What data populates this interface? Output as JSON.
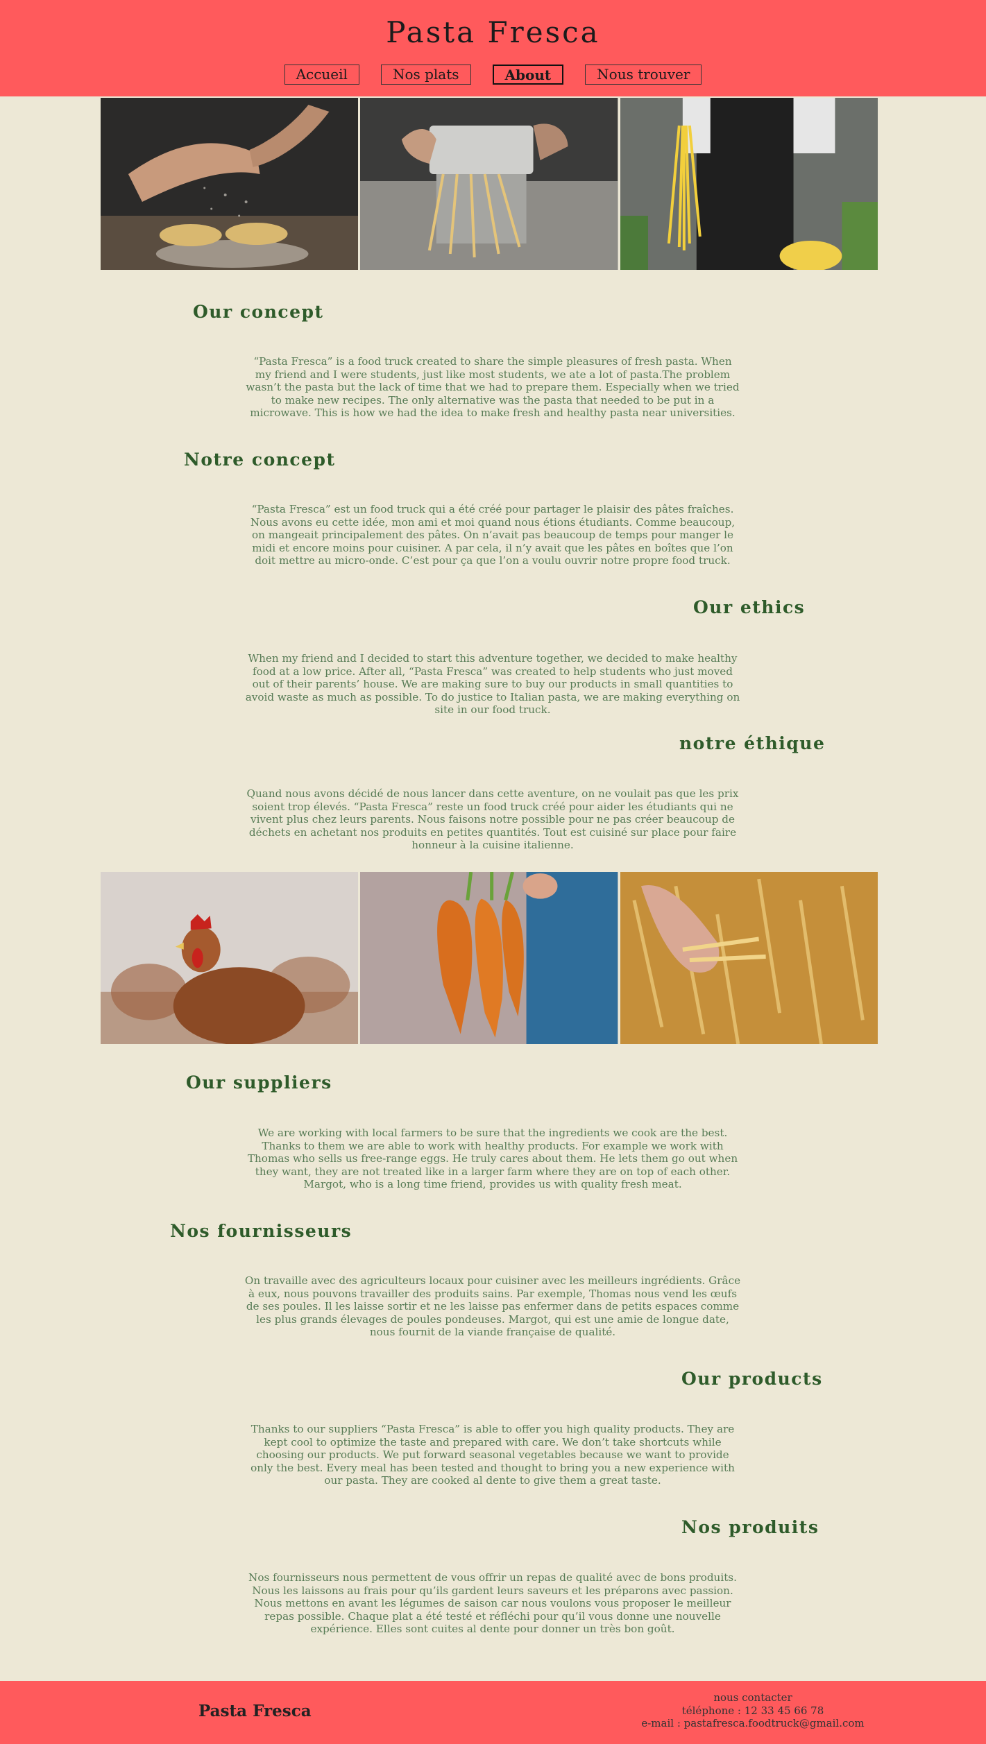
{
  "header": {
    "title": "Pasta Fresca",
    "nav": [
      "Accueil",
      "Nos plats",
      "About",
      "Nous trouver"
    ],
    "active": "About"
  },
  "gallery_top": [
    {
      "icon": "hands-flour-pasta-photo"
    },
    {
      "icon": "pasta-machine-photo"
    },
    {
      "icon": "chef-fresh-spaghetti-photo"
    }
  ],
  "sections": [
    {
      "title": "Our concept",
      "text": "“Pasta Fresca” is a food truck created to share the simple pleasures of fresh pasta. When my friend and I were students, just like most students, we ate a lot of pasta.The problem wasn’t the pasta but the lack of time that we had to prepare them. Especially when we tried to make new recipes. The only alternative was the pasta that needed to be put in a microwave. This is how we had the idea to make fresh and healthy pasta near universities."
    },
    {
      "title": "Notre concept",
      "text": "“Pasta Fresca” est un food truck qui a été créé pour partager le plaisir des pâtes fraîches. Nous avons eu cette idée, mon ami et moi quand nous étions étudiants. Comme beaucoup, on mangeait principalement des pâtes. On n’avait pas beaucoup de temps pour manger le midi et encore moins pour cuisiner. A par cela, il n’y avait que les pâtes en boîtes que l’on doit mettre au micro-onde. C’est pour ça que l’on a voulu ouvrir notre propre food truck."
    },
    {
      "title": "Our ethics",
      "text": "When my friend and I decided to start this adventure together, we decided to make healthy food at a low price. After all, “Pasta Fresca” was created to help students who just moved out of their parents’ house. We are making sure to buy our products in small quantities to avoid waste as much as possible. To do justice to Italian pasta, we are making everything on site in our food truck."
    },
    {
      "title": "notre éthique",
      "text": "Quand nous avons décidé de nous lancer dans cette aventure, on ne voulait pas que les prix soient trop élevés. “Pasta Fresca” reste un food truck créé pour aider les étudiants qui ne vivent plus chez leurs parents. Nous faisons notre possible pour ne pas créer beaucoup de déchets en achetant nos produits en petites quantités. Tout est cuisiné sur place pour faire honneur à la cuisine italienne."
    },
    {
      "title": "Our suppliers",
      "text": "We are working with local farmers to be sure that the ingredients we cook are the best. Thanks to them we are able to work with healthy products. For example we work with Thomas who sells us free-range eggs. He truly cares about them. He lets them go out when they want, they are not treated like in a larger farm where they are on top of each other. Margot, who is a long time friend, provides us with quality fresh meat."
    },
    {
      "title": "Nos fournisseurs",
      "text": "On travaille avec des agriculteurs locaux pour cuisiner avec les meilleurs ingrédients. Grâce à eux, nous pouvons travailler des produits sains. Par exemple, Thomas nous vend les œufs de ses poules. Il les laisse sortir et ne les laisse pas enfermer dans de petits espaces comme les plus grands élevages de poules pondeuses. Margot, qui est une amie de longue date, nous fournit de la viande française de qualité."
    },
    {
      "title": "Our products",
      "text": "Thanks to our suppliers “Pasta Fresca” is able to offer you high quality products. They are kept cool to optimize the taste and prepared with care. We don’t take shortcuts while choosing our products. We put forward seasonal vegetables because we want to provide only the best. Every meal has been tested and thought to bring you a new experience with our pasta. They are cooked al dente to give them a great taste."
    },
    {
      "title": "Nos produits",
      "text": "Nos fournisseurs nous permettent de vous offrir un repas de qualité avec de bons produits. Nous les laissons au frais pour qu’ils gardent leurs saveurs et les préparons avec passion. Nous mettons en avant les légumes de saison car nous voulons vous proposer le meilleur repas possible. Chaque plat a été testé et réfléchi pour qu’il vous donne une nouvelle expérience. Elles sont cuites al dente pour donner un très bon goût."
    }
  ],
  "gallery_bottom": [
    {
      "icon": "hen-photo"
    },
    {
      "icon": "carrots-photo"
    },
    {
      "icon": "wheat-field-photo"
    }
  ],
  "footer": {
    "brand": "Pasta Fresca",
    "contact_label": "nous contacter",
    "phone": "téléphone : 12 33 45 66 78",
    "email": "e-mail : pastafresca.foodtruck@gmail.com"
  },
  "colors": {
    "header_bg": "#ff5a5c",
    "page_bg": "#ede8d6",
    "title_green": "#2e5b2a",
    "text_green": "#577b55"
  }
}
